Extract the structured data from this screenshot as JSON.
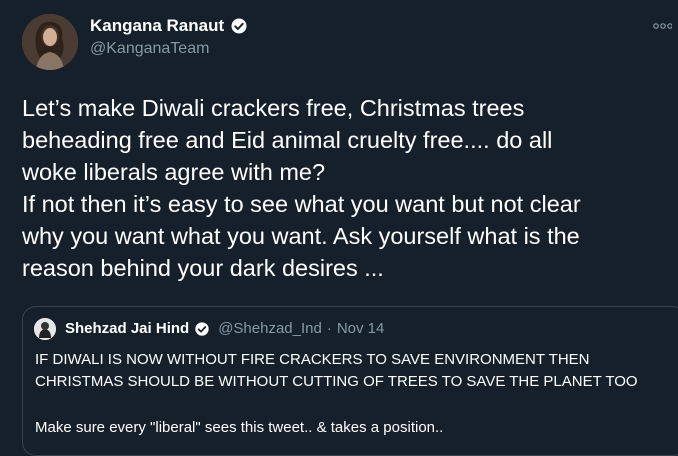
{
  "tweet": {
    "author_name": "Kangana Ranaut",
    "author_handle": "@KanganaTeam",
    "text": "Let’s make Diwali crackers free, Christmas trees\nbeheading free and Eid animal cruelty free.... do all\nwoke liberals agree with me?\nIf not then it’s easy to see what you want but not clear\nwhy you want what you want. Ask yourself what is the\nreason behind your dark desires ...",
    "more_icon": "more-options-icon",
    "verified_color": "#1d9bf0"
  },
  "quote": {
    "author_name": "Shehzad Jai Hind",
    "author_handle": "@Shehzad_Ind",
    "separator": "·",
    "date": "Nov 14",
    "text": "IF DIWALI IS NOW WITHOUT FIRE CRACKERS TO SAVE ENVIRONMENT THEN\nCHRISTMAS SHOULD BE WITHOUT CUTTING OF TREES TO SAVE THE PLANET TOO",
    "text2": "Make sure every \"liberal\" sees this tweet.. & takes a position.."
  }
}
